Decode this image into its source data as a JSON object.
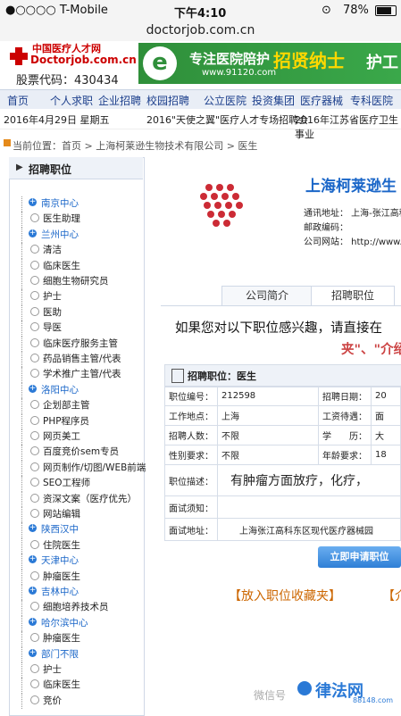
{
  "status": {
    "carrier": "●○○○○ T-Mobile",
    "time": "下午4:10",
    "battery": "78%"
  },
  "url": "doctorjob.com.cn",
  "header": {
    "logo_cn": "中国医疗人才网",
    "logo_site": "Doctorjob.com.cn",
    "stock": "股票代码：430434",
    "banner_text": "专注医院陪护",
    "banner_url": "www.91120.com",
    "banner_big": "招贤纳士",
    "banner_sub": "护工"
  },
  "nav": [
    "首页",
    "个人求职",
    "企业招聘",
    "校园招聘",
    "公立医院",
    "投资集团",
    "医疗器械",
    "专科医院"
  ],
  "datebar": {
    "date": "2016年4月29日 星期五",
    "news1": "2016\"天使之翼\"医疗人才专场招聘会",
    "news2": "2016年江苏省医疗卫生事业"
  },
  "breadcrumb": "当前位置：首页 > 上海柯莱逊生物技术有限公司 > 医生",
  "sidebar": {
    "title": "招聘职位",
    "items": [
      {
        "label": "南京中心",
        "center": true
      },
      {
        "label": "医生助理",
        "center": false
      },
      {
        "label": "兰州中心",
        "center": true
      },
      {
        "label": "清洁",
        "center": false
      },
      {
        "label": "临床医生",
        "center": false
      },
      {
        "label": "细胞生物研究员",
        "center": false
      },
      {
        "label": "护士",
        "center": false
      },
      {
        "label": "医助",
        "center": false
      },
      {
        "label": "导医",
        "center": false
      },
      {
        "label": "临床医疗服务主管",
        "center": false
      },
      {
        "label": "药品销售主管/代表",
        "center": false
      },
      {
        "label": "学术推广主管/代表",
        "center": false
      },
      {
        "label": "洛阳中心",
        "center": true
      },
      {
        "label": "企划部主管",
        "center": false
      },
      {
        "label": "PHP程序员",
        "center": false
      },
      {
        "label": "网页美工",
        "center": false
      },
      {
        "label": "百度竞价sem专员",
        "center": false
      },
      {
        "label": "网页制作/切图/WEB前端",
        "center": false
      },
      {
        "label": "SEO工程师",
        "center": false
      },
      {
        "label": "资深文案（医疗优先）",
        "center": false
      },
      {
        "label": "网站编辑",
        "center": false
      },
      {
        "label": "陕西汉中",
        "center": true
      },
      {
        "label": "住院医生",
        "center": false
      },
      {
        "label": "天津中心",
        "center": true
      },
      {
        "label": "肿瘤医生",
        "center": false
      },
      {
        "label": "吉林中心",
        "center": true
      },
      {
        "label": "细胞培养技术员",
        "center": false
      },
      {
        "label": "哈尔滨中心",
        "center": true
      },
      {
        "label": "肿瘤医生",
        "center": false
      },
      {
        "label": "部门不限",
        "center": true
      },
      {
        "label": "护士",
        "center": false
      },
      {
        "label": "临床医生",
        "center": false
      },
      {
        "label": "竞价",
        "center": false
      }
    ]
  },
  "company": {
    "name": "上海柯莱逊生",
    "address": "通讯地址：  上海-张江高科",
    "postcode": "邮政编码：",
    "website": "公司网站：  http://www.cla"
  },
  "tabs": [
    "公司简介",
    "招聘职位"
  ],
  "notice": "如果您对以下职位感兴趣，请直接在",
  "notice2": "夹\"、\"介绍",
  "job": {
    "title": "招聘职位：医生",
    "rows": [
      {
        "l1": "职位编号：",
        "v1": "212598",
        "l2": "招聘日期：",
        "v2": "20"
      },
      {
        "l1": "工作地点：",
        "v1": "上海",
        "l2": "工资待遇：",
        "v2": "面"
      },
      {
        "l1": "招聘人数：",
        "v1": "不限",
        "l2": "学　　历：",
        "v2": "大"
      },
      {
        "l1": "性别要求：",
        "v1": "不限",
        "l2": "年龄要求：",
        "v2": "18"
      }
    ],
    "desc_label": "职位描述：",
    "desc": "有肿瘤方面放疗，化疗，",
    "interview_label": "面试须知：",
    "address_label": "面试地址：",
    "address": "上海张江高科东区现代医疗器械园"
  },
  "apply_button": "立即申请职位",
  "collect": "【放入职位收藏夹】",
  "collect2": "【介",
  "watermark": {
    "wechat": "微信号",
    "brand": "律法网",
    "brand_url": "88148.com"
  },
  "colors": {
    "link_blue": "#1a66c8",
    "banner_green": "#2f8f3a",
    "brand_red": "#cc0000"
  }
}
